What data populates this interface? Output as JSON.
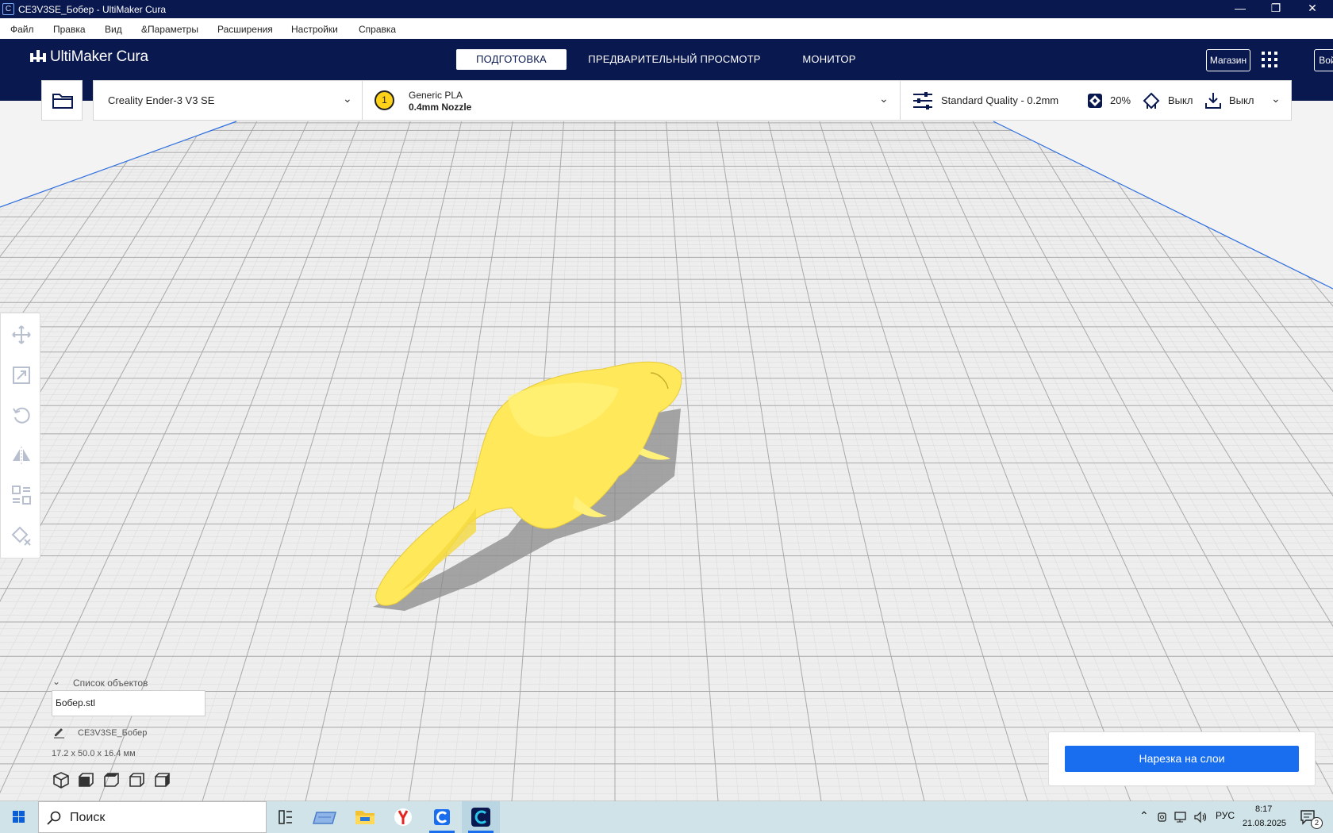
{
  "window": {
    "title": "CE3V3SE_Бобер - UltiMaker Cura",
    "app_icon": "C",
    "controls": {
      "minimize": "—",
      "restore": "❐",
      "close": "✕"
    }
  },
  "menu": [
    "Файл",
    "Правка",
    "Вид",
    "&Параметры",
    "Расширения",
    "Настройки",
    "Справка"
  ],
  "header": {
    "logo": "UltiMaker Cura",
    "stages": [
      {
        "label": "ПОДГОТОВКА",
        "active": true
      },
      {
        "label": "ПРЕДВАРИТЕЛЬНЫЙ ПРОСМОТР",
        "active": false
      },
      {
        "label": "МОНИТОР",
        "active": false
      }
    ],
    "marketplace": "Магазин",
    "signin": "Войти",
    "apps_icon": "apps-grid-icon"
  },
  "printer": {
    "name": "Creality Ender-3 V3 SE"
  },
  "material": {
    "badge": "1",
    "name": "Generic PLA",
    "nozzle": "0.4mm Nozzle"
  },
  "print_settings": {
    "quality": "Standard Quality - 0.2mm",
    "infill": "20%",
    "support": "Выкл",
    "adhesion": "Выкл"
  },
  "colors": {
    "header": "#0a1850",
    "model": "#ffee58",
    "accent": "#196ef0",
    "bed_edge": "#2d6ee0"
  },
  "side_tools": [
    "move-icon",
    "scale-icon",
    "rotate-icon",
    "mirror-icon",
    "per-model-settings-icon",
    "support-blocker-icon"
  ],
  "object_list": {
    "title": "Список объектов",
    "item": "Бобер.stl",
    "job_name": "CE3V3SE_Бобер",
    "dimensions": "17.2 x 50.0 x 16.4 мм"
  },
  "view_icons": [
    "3d-view-icon",
    "front-view-icon",
    "top-view-icon",
    "left-view-icon",
    "right-view-icon"
  ],
  "slice_button": "Нарезка на слои",
  "taskbar": {
    "search_placeholder": "Поиск",
    "lang": "РУС",
    "time": "8:17",
    "date": "21.08.2025",
    "notifications": "2"
  }
}
